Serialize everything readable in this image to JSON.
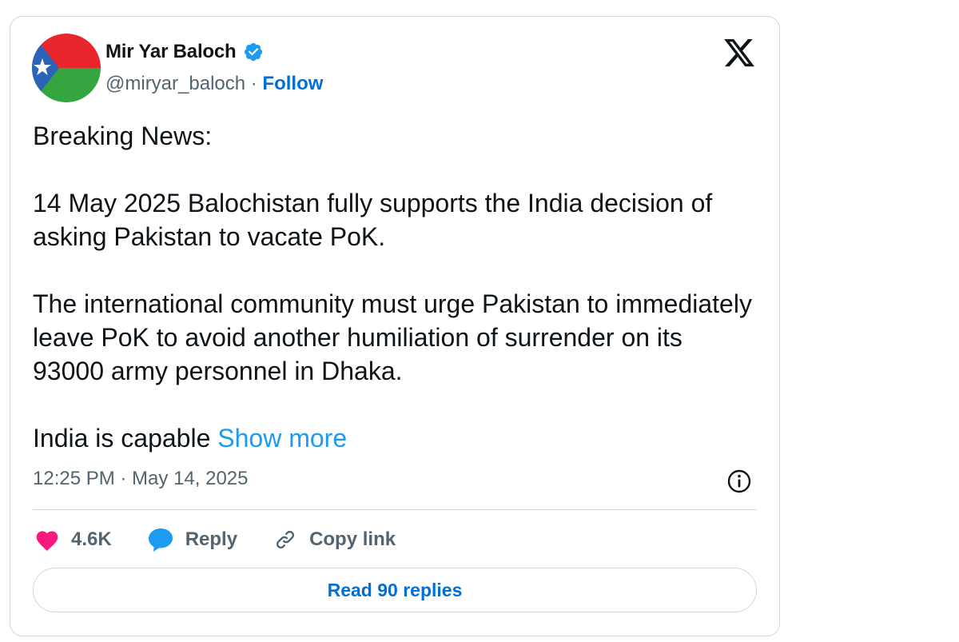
{
  "author": {
    "display_name": "Mir Yar Baloch",
    "handle": "@miryar_baloch",
    "separator": " · ",
    "follow_label": "Follow",
    "verified": true
  },
  "tweet": {
    "paragraphs": [
      "Breaking News:",
      "14 May 2025 Balochistan fully supports the India decision of asking Pakistan to vacate PoK.",
      "The international community must urge Pakistan to immediately leave PoK to avoid another humiliation of surrender on its 93000 army personnel in Dhaka."
    ],
    "truncated_text": "India is capable ",
    "show_more_label": "Show more",
    "timestamp": "12:25 PM · May 14, 2025"
  },
  "actions": {
    "like_count": "4.6K",
    "reply_label": "Reply",
    "copy_link_label": "Copy link"
  },
  "read_replies_label": "Read 90 replies",
  "icons": {
    "avatar": "baloch-flag-avatar",
    "verified": "verified-badge-icon",
    "brand": "x-logo-icon",
    "info": "info-icon",
    "like": "heart-icon",
    "reply": "reply-bubble-icon",
    "copy": "link-icon"
  },
  "colors": {
    "link_blue": "#006fd6",
    "show_more_blue": "#1d9bf0",
    "verified_blue": "#1d9bf0",
    "heart_pink": "#f91880",
    "secondary_text": "#536471",
    "border": "#cfd9de",
    "flag_red": "#e8262c",
    "flag_green": "#35a53f",
    "flag_blue": "#2a63b8"
  }
}
